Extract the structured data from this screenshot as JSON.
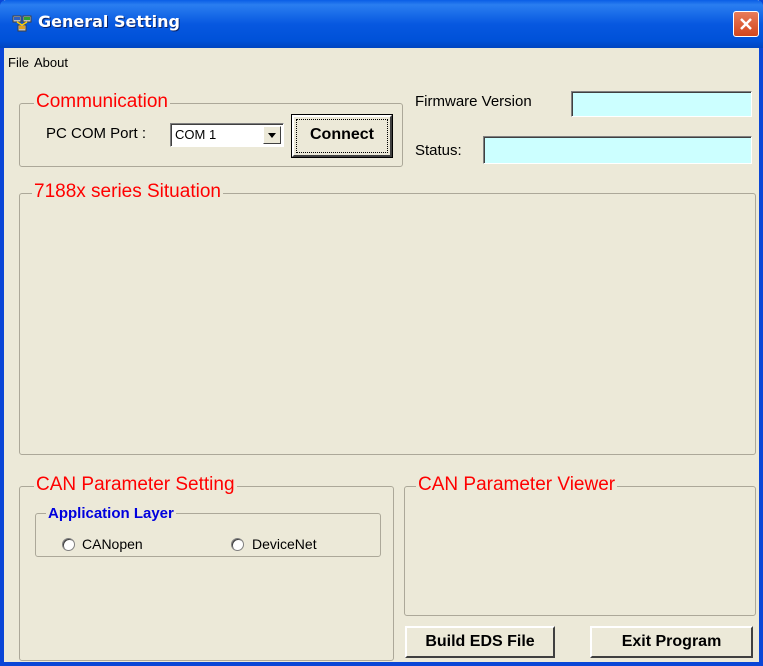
{
  "window": {
    "title": "General Setting"
  },
  "menu": [
    "File",
    "About"
  ],
  "communication": {
    "legend": "Communication",
    "com_port_label": "PC COM Port :",
    "com_port_value": "COM 1",
    "connect_label": "Connect"
  },
  "firmware": {
    "label": "Firmware Version",
    "value": ""
  },
  "status": {
    "label": "Status:",
    "value": ""
  },
  "situation": {
    "legend": "7188x series Situation"
  },
  "can_setting": {
    "legend": "CAN Parameter Setting",
    "app_layer_legend": "Application Layer",
    "options": [
      "CANopen",
      "DeviceNet"
    ]
  },
  "can_viewer": {
    "legend": "CAN Parameter Viewer"
  },
  "buttons": {
    "build_eds": "Build EDS File",
    "exit": "Exit Program"
  },
  "colors": {
    "title_bar": "#0058e0",
    "group_title": "#ff0000",
    "sub_group_title": "#0000dd",
    "textbox_bg": "#ccffff",
    "window_bg": "#ece9d8"
  }
}
